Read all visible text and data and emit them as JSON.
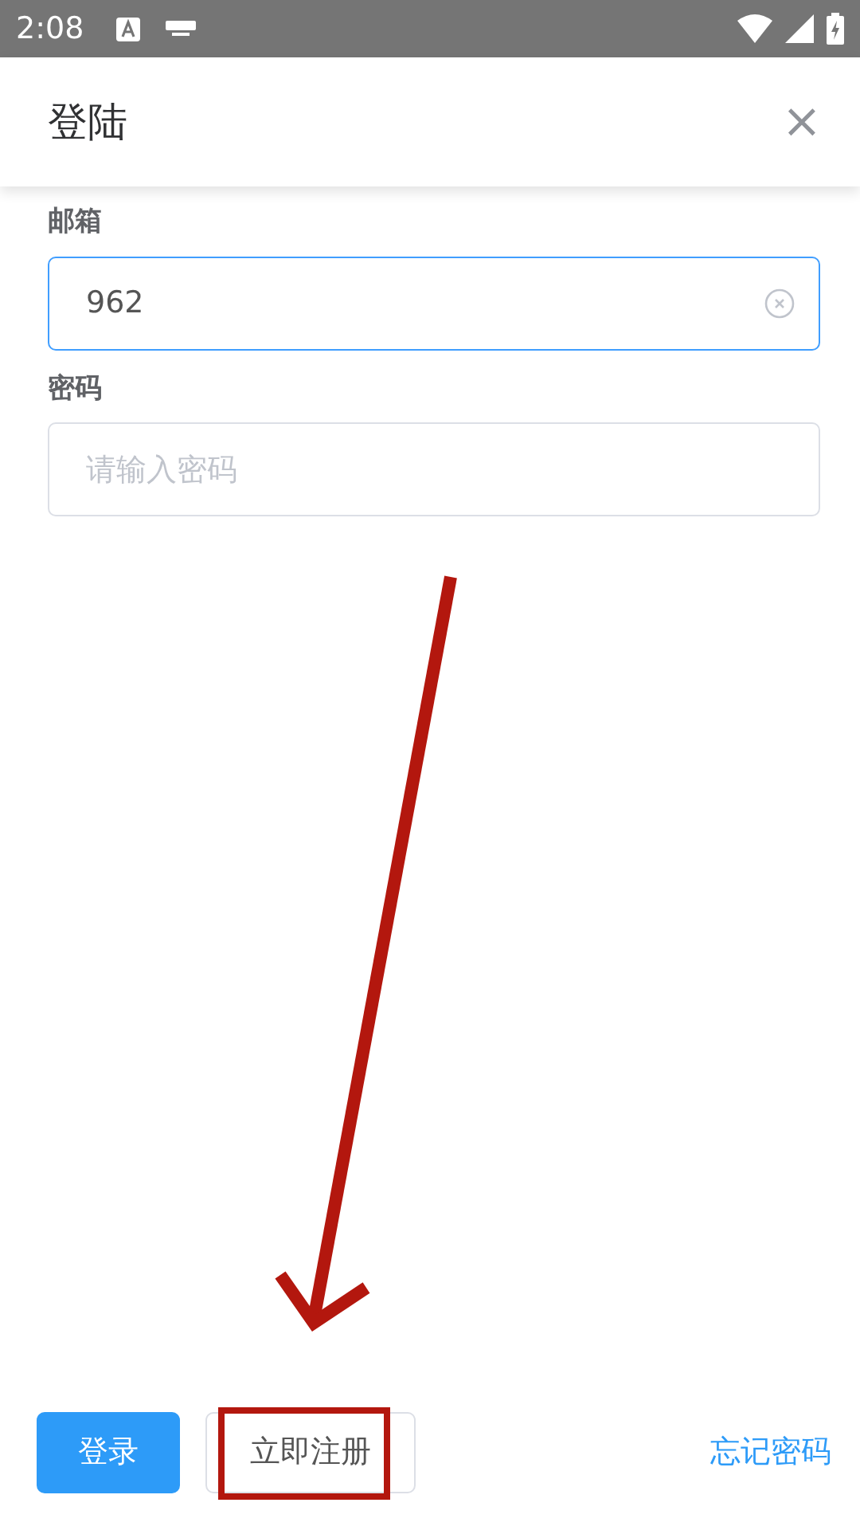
{
  "status_bar": {
    "time": "2:08"
  },
  "dialog": {
    "title": "登陆",
    "close": "×"
  },
  "fields": [
    {
      "label": "邮箱",
      "value": "962",
      "focused": true,
      "clearable": true
    },
    {
      "label": "密码",
      "placeholder": "请输入密码",
      "focused": false,
      "clearable": false
    }
  ],
  "buttons": [
    {
      "kind": "primary",
      "label": "登录"
    },
    {
      "kind": "outline",
      "label": "立即注册"
    },
    {
      "kind": "link",
      "label": "忘记密码"
    }
  ],
  "annotation": {
    "arrow": true,
    "highlight": true
  }
}
